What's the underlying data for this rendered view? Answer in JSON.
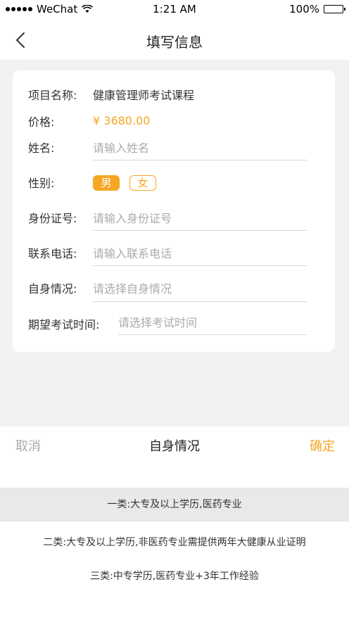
{
  "status_bar": {
    "carrier": "WeChat",
    "time": "1:21 AM",
    "battery": "100%"
  },
  "nav": {
    "title": "填写信息"
  },
  "form": {
    "project_label": "项目名称:",
    "project_value": "健康管理师考试课程",
    "price_label": "价格:",
    "price_value": "¥ 3680.00",
    "name_label": "姓名:",
    "name_placeholder": "请输入姓名",
    "gender_label": "性别:",
    "gender_options": [
      "男",
      "女"
    ],
    "gender_selected": "男",
    "id_label": "身份证号:",
    "id_placeholder": "请输入身份证号",
    "phone_label": "联系电话:",
    "phone_placeholder": "请输入联系电话",
    "status_label": "自身情况:",
    "status_placeholder": "请选择自身情况",
    "exam_time_label": "期望考试时间:",
    "exam_time_placeholder": "请选择考试时间"
  },
  "picker": {
    "cancel": "取消",
    "title": "自身情况",
    "confirm": "确定",
    "options": [
      "一类:大专及以上学历,医药专业",
      "二类:大专及以上学历,非医药专业需提供两年大健康从业证明",
      "三类:中专学历,医药专业+3年工作经验"
    ],
    "selected_index": 0
  },
  "colors": {
    "accent": "#f6a623",
    "background": "#f2f2f2",
    "card": "#ffffff"
  }
}
